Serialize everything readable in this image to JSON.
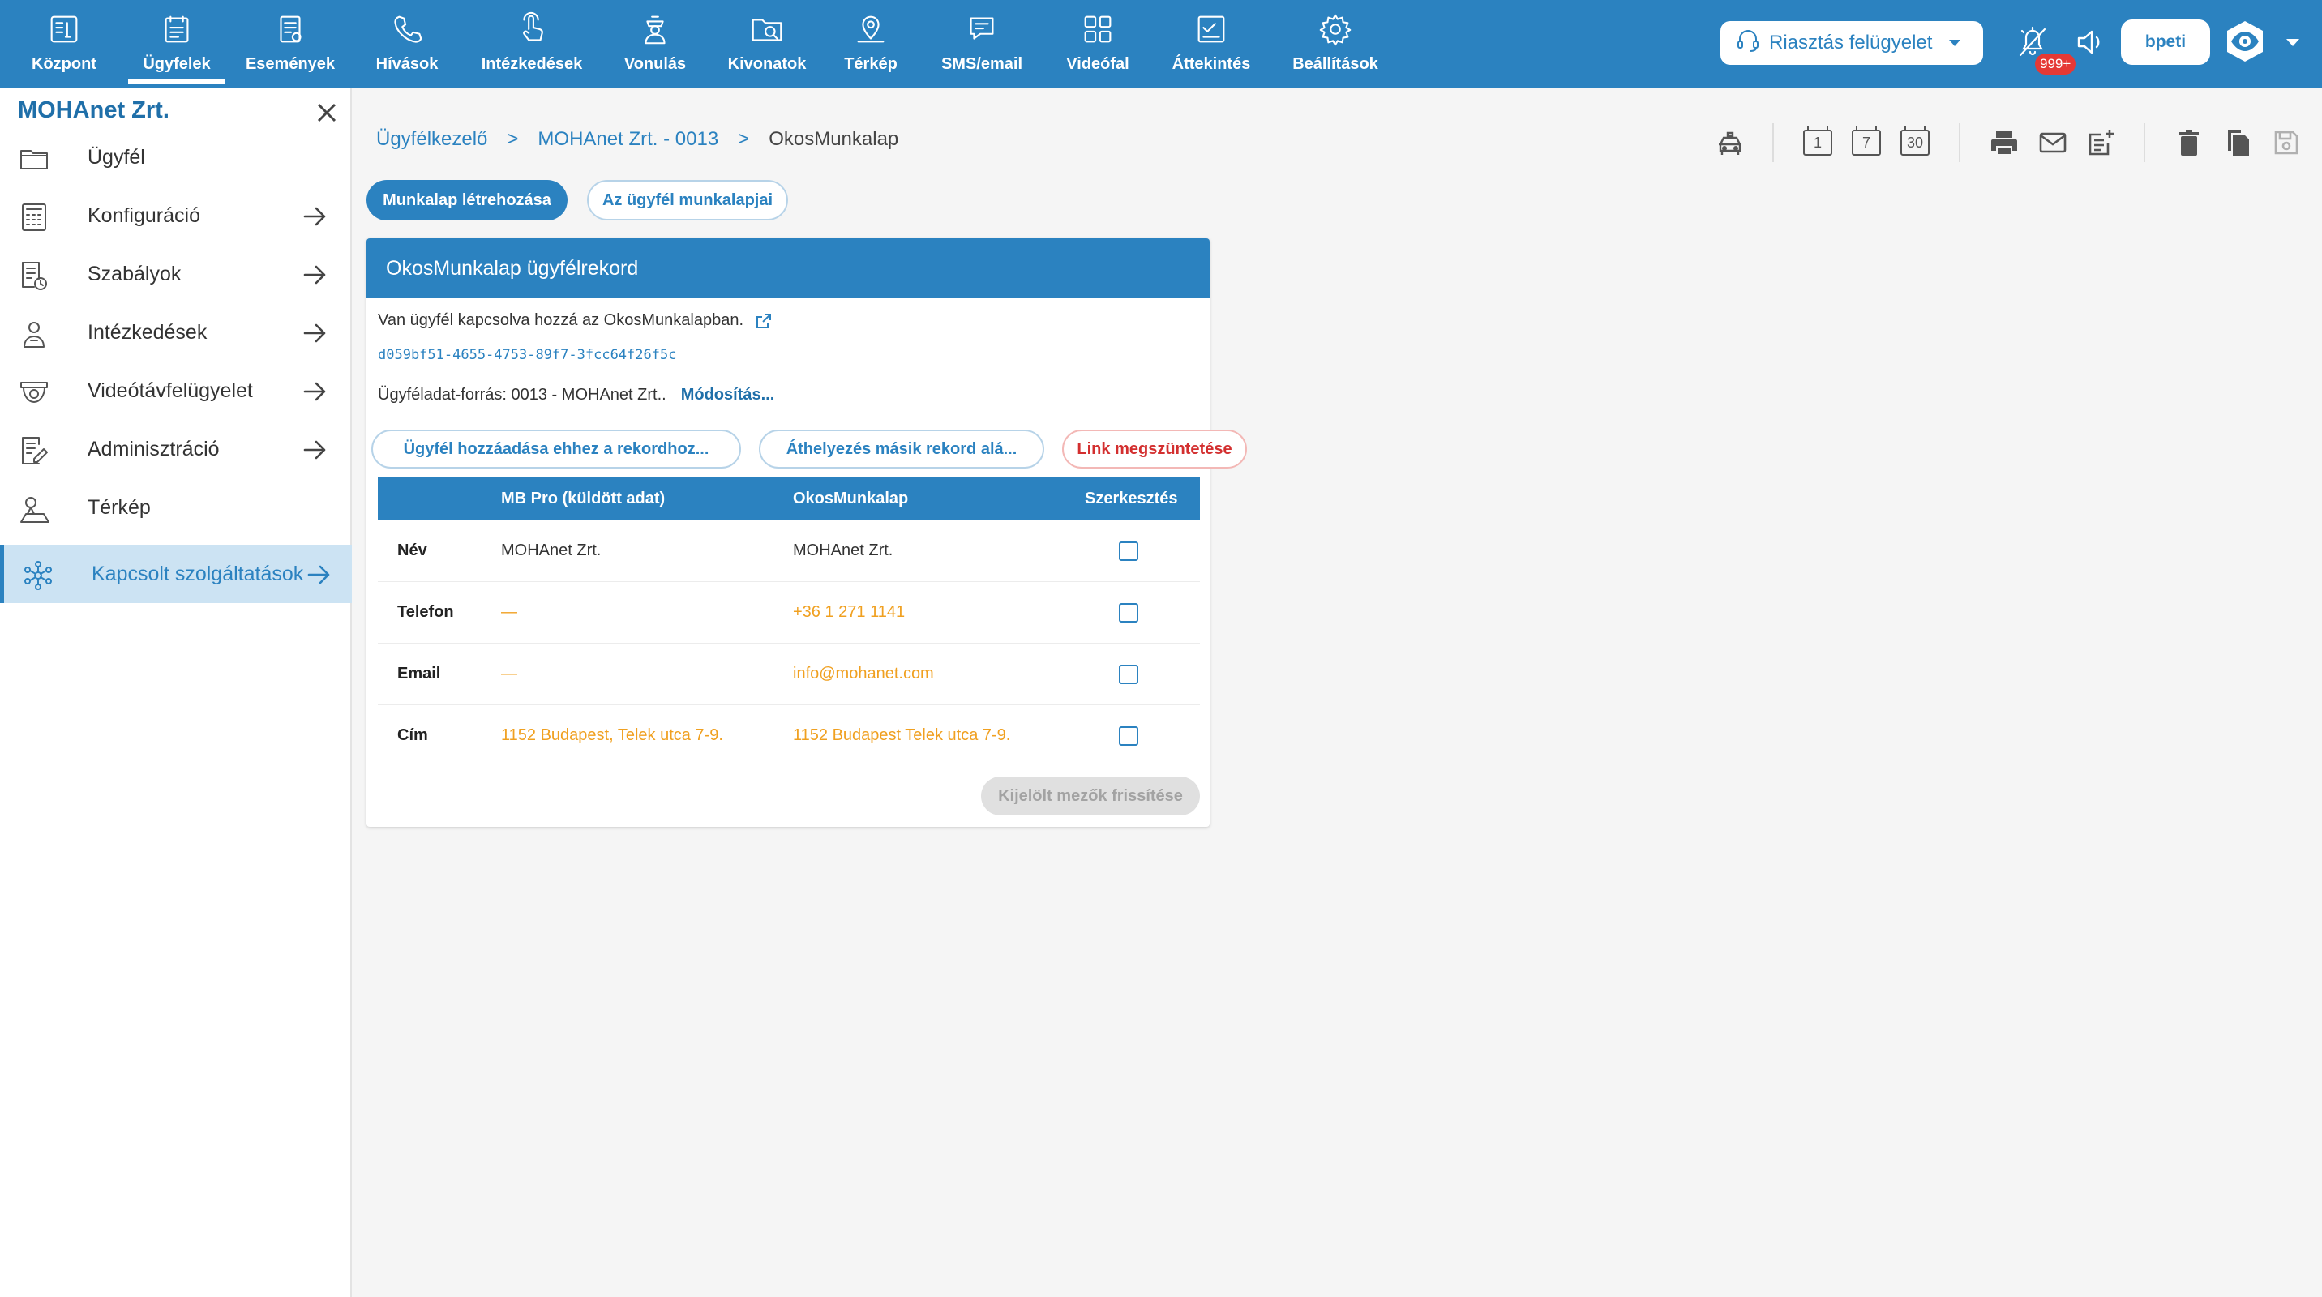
{
  "nav": {
    "items": [
      {
        "label": "Központ",
        "icon": "dashboard-icon"
      },
      {
        "label": "Ügyfelek",
        "icon": "customers-icon",
        "active": true
      },
      {
        "label": "Események",
        "icon": "events-icon"
      },
      {
        "label": "Hívások",
        "icon": "phone-icon"
      },
      {
        "label": "Intézkedések",
        "icon": "touch-icon"
      },
      {
        "label": "Vonulás",
        "icon": "guard-icon"
      },
      {
        "label": "Kivonatok",
        "icon": "folder-search-icon"
      },
      {
        "label": "Térkép",
        "icon": "map-pin-icon"
      },
      {
        "label": "SMS/email",
        "icon": "chat-icon"
      },
      {
        "label": "Videófal",
        "icon": "grid-icon"
      },
      {
        "label": "Áttekintés",
        "icon": "checklist-icon"
      },
      {
        "label": "Beállítások",
        "icon": "gear-icon"
      }
    ],
    "alarm_select": "Riasztás felügyelet",
    "notification_count": "999+",
    "user": "bpeti"
  },
  "sidebar": {
    "title": "MOHAnet Zrt.",
    "items": [
      {
        "label": "Ügyfél",
        "icon": "folder-icon"
      },
      {
        "label": "Konfiguráció",
        "icon": "calculator-icon"
      },
      {
        "label": "Szabályok",
        "icon": "rules-icon"
      },
      {
        "label": "Intézkedések",
        "icon": "person-icon"
      },
      {
        "label": "Videótávfelügyelet",
        "icon": "camera-icon"
      },
      {
        "label": "Adminisztráció",
        "icon": "edit-doc-icon"
      },
      {
        "label": "Térkép",
        "icon": "map-icon"
      },
      {
        "label": "Kapcsolt szolgáltatások",
        "icon": "network-icon",
        "active": true
      }
    ]
  },
  "breadcrumb": {
    "root": "Ügyfélkezelő",
    "sep": ">",
    "customer": "MOHAnet Zrt. - 0013",
    "current": "OkosMunkalap"
  },
  "toolbar": {
    "day1": "1",
    "day7": "7",
    "day30": "30"
  },
  "actions": {
    "create": "Munkalap létrehozása",
    "list": "Az ügyfél munkalapjai"
  },
  "card": {
    "header": "OkosMunkalap ügyfélrekord",
    "info": "Van ügyfél kapcsolva hozzá az OkosMunkalapban.",
    "uuid": "d059bf51-4655-4753-89f7-3fcc64f26f5c",
    "source_label": "Ügyféladat-forrás: 0013 - MOHAnet Zrt..",
    "source_link": "Módosítás...",
    "btn_add": "Ügyfél hozzáadása ehhez a rekordhoz...",
    "btn_move": "Áthelyezés másik rekord alá...",
    "btn_unlink": "Link megszüntetése",
    "table": {
      "headers": [
        "MB Pro (küldött adat)",
        "OkosMunkalap",
        "Szerkesztés"
      ],
      "rows": [
        {
          "label": "Név",
          "mbpro": "MOHAnet Zrt.",
          "okos": "MOHAnet Zrt."
        },
        {
          "label": "Telefon",
          "mbpro": "—",
          "okos": "+36 1 271 1141"
        },
        {
          "label": "Email",
          "mbpro": "—",
          "okos": "info@mohanet.com"
        },
        {
          "label": "Cím",
          "mbpro": "1152 Budapest, Telek utca 7-9.",
          "okos": "1152 Budapest Telek utca 7-9."
        }
      ]
    },
    "update_btn": "Kijelölt mezők frissítése"
  },
  "colors": {
    "primary": "#2b82c0",
    "accent_text": "#f0a020",
    "danger": "#d32f2f",
    "badge": "#e53935"
  }
}
